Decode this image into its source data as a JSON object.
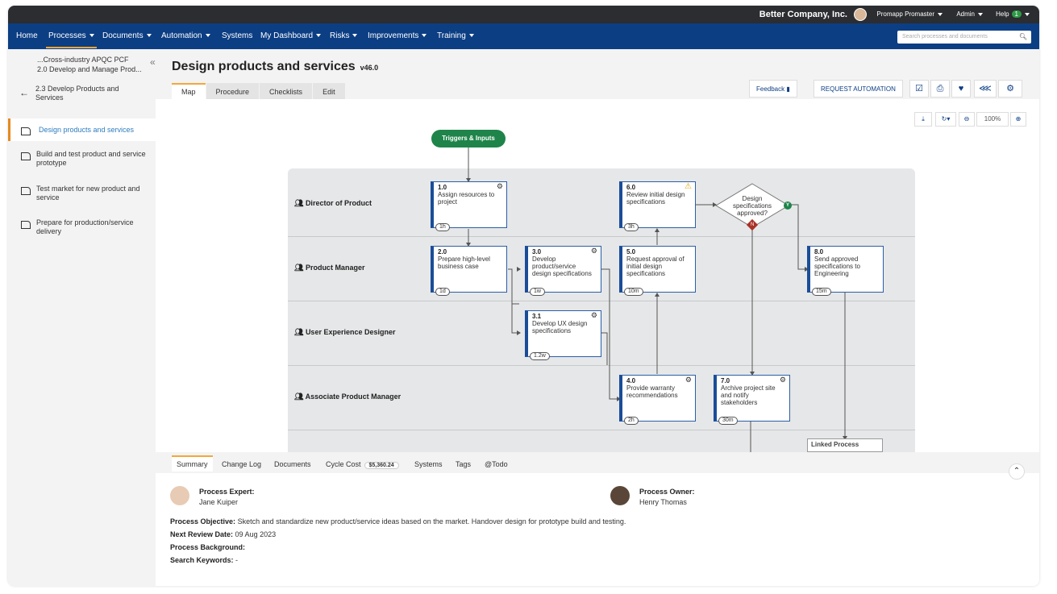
{
  "topbar": {
    "company": "Better Company, Inc.",
    "user": "Promapp Promaster",
    "admin": "Admin",
    "help": "Help",
    "help_badge": "1"
  },
  "nav": {
    "items": [
      "Home",
      "Processes",
      "Documents",
      "Automation",
      "Systems",
      "My Dashboard",
      "Risks",
      "Improvements",
      "Training"
    ],
    "search_placeholder": "Search processes and documents"
  },
  "sidebar": {
    "crumb_line1": "...Cross-industry APQC PCF",
    "crumb_line2": "2.0 Develop and Manage Prod...",
    "parent": "2.3 Develop Products and Services",
    "items": [
      "Design products and services",
      "Build and test product and service prototype",
      "Test market for new product and service",
      "Prepare for production/service delivery"
    ]
  },
  "header": {
    "title": "Design products and services",
    "version": "v46.0",
    "tabs": [
      "Map",
      "Procedure",
      "Checklists",
      "Edit"
    ],
    "feedback": "Feedback",
    "request_automation": "REQUEST AUTOMATION"
  },
  "map": {
    "zoom": "100%",
    "trigger": "Triggers & Inputs",
    "lanes": [
      "Director of Product",
      "Product Manager",
      "User Experience Designer",
      "Associate Product Manager"
    ],
    "activities": [
      {
        "num": "1.0",
        "text": "Assign resources to project",
        "dur": "1h"
      },
      {
        "num": "2.0",
        "text": "Prepare high-level business case",
        "dur": "1d"
      },
      {
        "num": "3.0",
        "text": "Develop product/service design specifications",
        "dur": "1w"
      },
      {
        "num": "3.1",
        "text": "Develop UX design specifications",
        "dur": "1.2w"
      },
      {
        "num": "4.0",
        "text": "Provide warranty recommendations",
        "dur": "2h"
      },
      {
        "num": "5.0",
        "text": "Request approval of initial design specifications",
        "dur": "10m"
      },
      {
        "num": "6.0",
        "text": "Review initial design specifications",
        "dur": "3h"
      },
      {
        "num": "7.0",
        "text": "Archive project site and notify stakeholders",
        "dur": "30m"
      },
      {
        "num": "8.0",
        "text": "Send approved specifications to Engineering",
        "dur": "15m"
      }
    ],
    "decision": "Design specifications approved?",
    "yes": "Y",
    "no": "N",
    "linked": "Linked Process"
  },
  "bottom": {
    "tabs": [
      "Summary",
      "Change Log",
      "Documents",
      "Cycle Cost",
      "Systems",
      "Tags",
      "@Todo"
    ],
    "cycle_cost": "$5,360.24",
    "expert_label": "Process Expert:",
    "expert": "Jane Kuiper",
    "owner_label": "Process Owner:",
    "owner": "Henry Thomas",
    "objective_label": "Process Objective:",
    "objective": "Sketch and standardize new product/service ideas based on the market. Handover design for prototype build and testing.",
    "review_label": "Next Review Date:",
    "review": "09 Aug 2023",
    "background_label": "Process Background:",
    "keywords_label": "Search Keywords:",
    "keywords": "-"
  }
}
